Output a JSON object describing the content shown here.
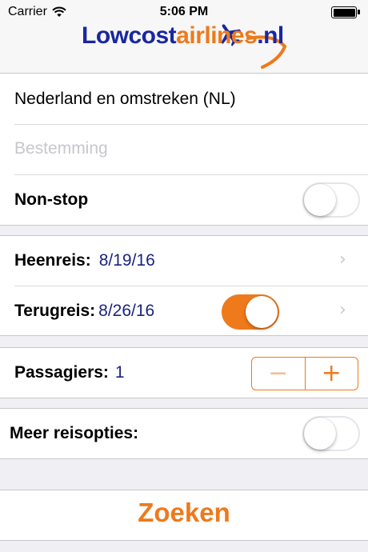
{
  "status_bar": {
    "carrier": "Carrier",
    "time": "5:06 PM"
  },
  "logo": {
    "part1": "Lowcost",
    "part2": "airlines",
    "part3": ".nl"
  },
  "route": {
    "origin": "Nederland en omstreken (NL)",
    "destination_placeholder": "Bestemming",
    "nonstop_label": "Non-stop",
    "nonstop_on": false
  },
  "dates": {
    "outbound_label": "Heenreis:",
    "outbound_value": "8/19/16",
    "return_label": "Terugreis:",
    "return_value": "8/26/16",
    "return_on": true
  },
  "passengers": {
    "label": "Passagiers:",
    "count": "1"
  },
  "options": {
    "label": "Meer reisopties:",
    "enabled": false
  },
  "search_button": "Zoeken",
  "colors": {
    "accent": "#ee7a1c",
    "value_blue": "#1b2480",
    "logo_blue": "#1a27a0"
  },
  "icons": [
    "wifi-icon",
    "battery-icon",
    "airplane-icon",
    "chevron-right-icon",
    "minus-icon",
    "plus-icon"
  ]
}
